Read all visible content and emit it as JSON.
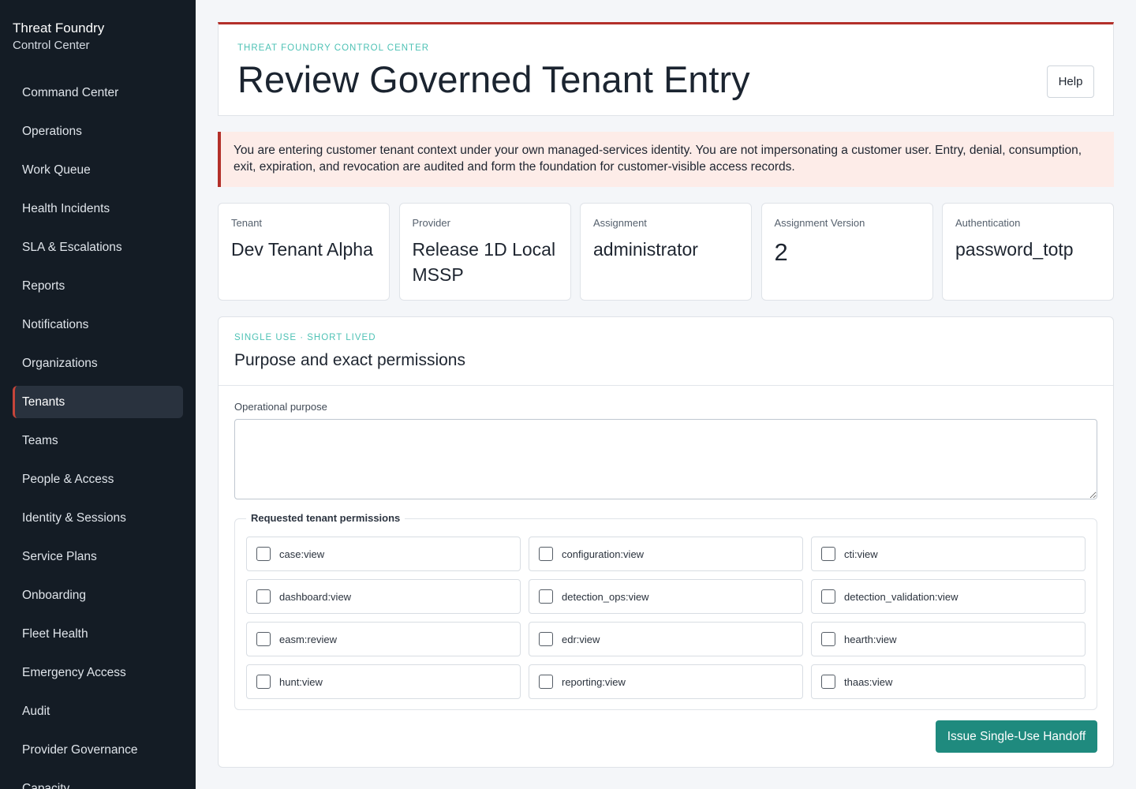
{
  "brand": {
    "title": "Threat Foundry",
    "subtitle": "Control Center"
  },
  "sidebar": {
    "items": [
      {
        "label": "Command Center",
        "active": false
      },
      {
        "label": "Operations",
        "active": false
      },
      {
        "label": "Work Queue",
        "active": false
      },
      {
        "label": "Health Incidents",
        "active": false
      },
      {
        "label": "SLA & Escalations",
        "active": false
      },
      {
        "label": "Reports",
        "active": false
      },
      {
        "label": "Notifications",
        "active": false
      },
      {
        "label": "Organizations",
        "active": false
      },
      {
        "label": "Tenants",
        "active": true
      },
      {
        "label": "Teams",
        "active": false
      },
      {
        "label": "People & Access",
        "active": false
      },
      {
        "label": "Identity & Sessions",
        "active": false
      },
      {
        "label": "Service Plans",
        "active": false
      },
      {
        "label": "Onboarding",
        "active": false
      },
      {
        "label": "Fleet Health",
        "active": false
      },
      {
        "label": "Emergency Access",
        "active": false
      },
      {
        "label": "Audit",
        "active": false
      },
      {
        "label": "Provider Governance",
        "active": false
      },
      {
        "label": "Capacity",
        "active": false
      }
    ]
  },
  "header": {
    "eyebrow": "THREAT FOUNDRY CONTROL CENTER",
    "title": "Review Governed Tenant Entry",
    "help_label": "Help"
  },
  "notice": {
    "text": "You are entering customer tenant context under your own managed-services identity. You are not impersonating a customer user. Entry, denial, consumption, exit, expiration, and revocation are audited and form the foundation for customer-visible access records."
  },
  "stats": [
    {
      "label": "Tenant",
      "value": "Dev Tenant Alpha"
    },
    {
      "label": "Provider",
      "value": "Release 1D Local MSSP"
    },
    {
      "label": "Assignment",
      "value": "administrator"
    },
    {
      "label": "Assignment Version",
      "value": "2"
    },
    {
      "label": "Authentication",
      "value": "password_totp"
    }
  ],
  "form": {
    "eyebrow": "SINGLE USE · SHORT LIVED",
    "title": "Purpose and exact permissions",
    "purpose_label": "Operational purpose",
    "purpose_value": "",
    "permissions_legend": "Requested tenant permissions",
    "permissions": [
      {
        "label": "case:view",
        "checked": false
      },
      {
        "label": "configuration:view",
        "checked": false
      },
      {
        "label": "cti:view",
        "checked": false
      },
      {
        "label": "dashboard:view",
        "checked": false
      },
      {
        "label": "detection_ops:view",
        "checked": false
      },
      {
        "label": "detection_validation:view",
        "checked": false
      },
      {
        "label": "easm:review",
        "checked": false
      },
      {
        "label": "edr:view",
        "checked": false
      },
      {
        "label": "hearth:view",
        "checked": false
      },
      {
        "label": "hunt:view",
        "checked": false
      },
      {
        "label": "reporting:view",
        "checked": false
      },
      {
        "label": "thaas:view",
        "checked": false
      }
    ],
    "submit_label": "Issue Single-Use Handoff"
  },
  "colors": {
    "sidebar_bg": "#141c25",
    "accent_red": "#b3302a",
    "accent_teal": "#4ec2b5",
    "button_teal": "#1f8a7e",
    "notice_bg": "#fdece8"
  }
}
